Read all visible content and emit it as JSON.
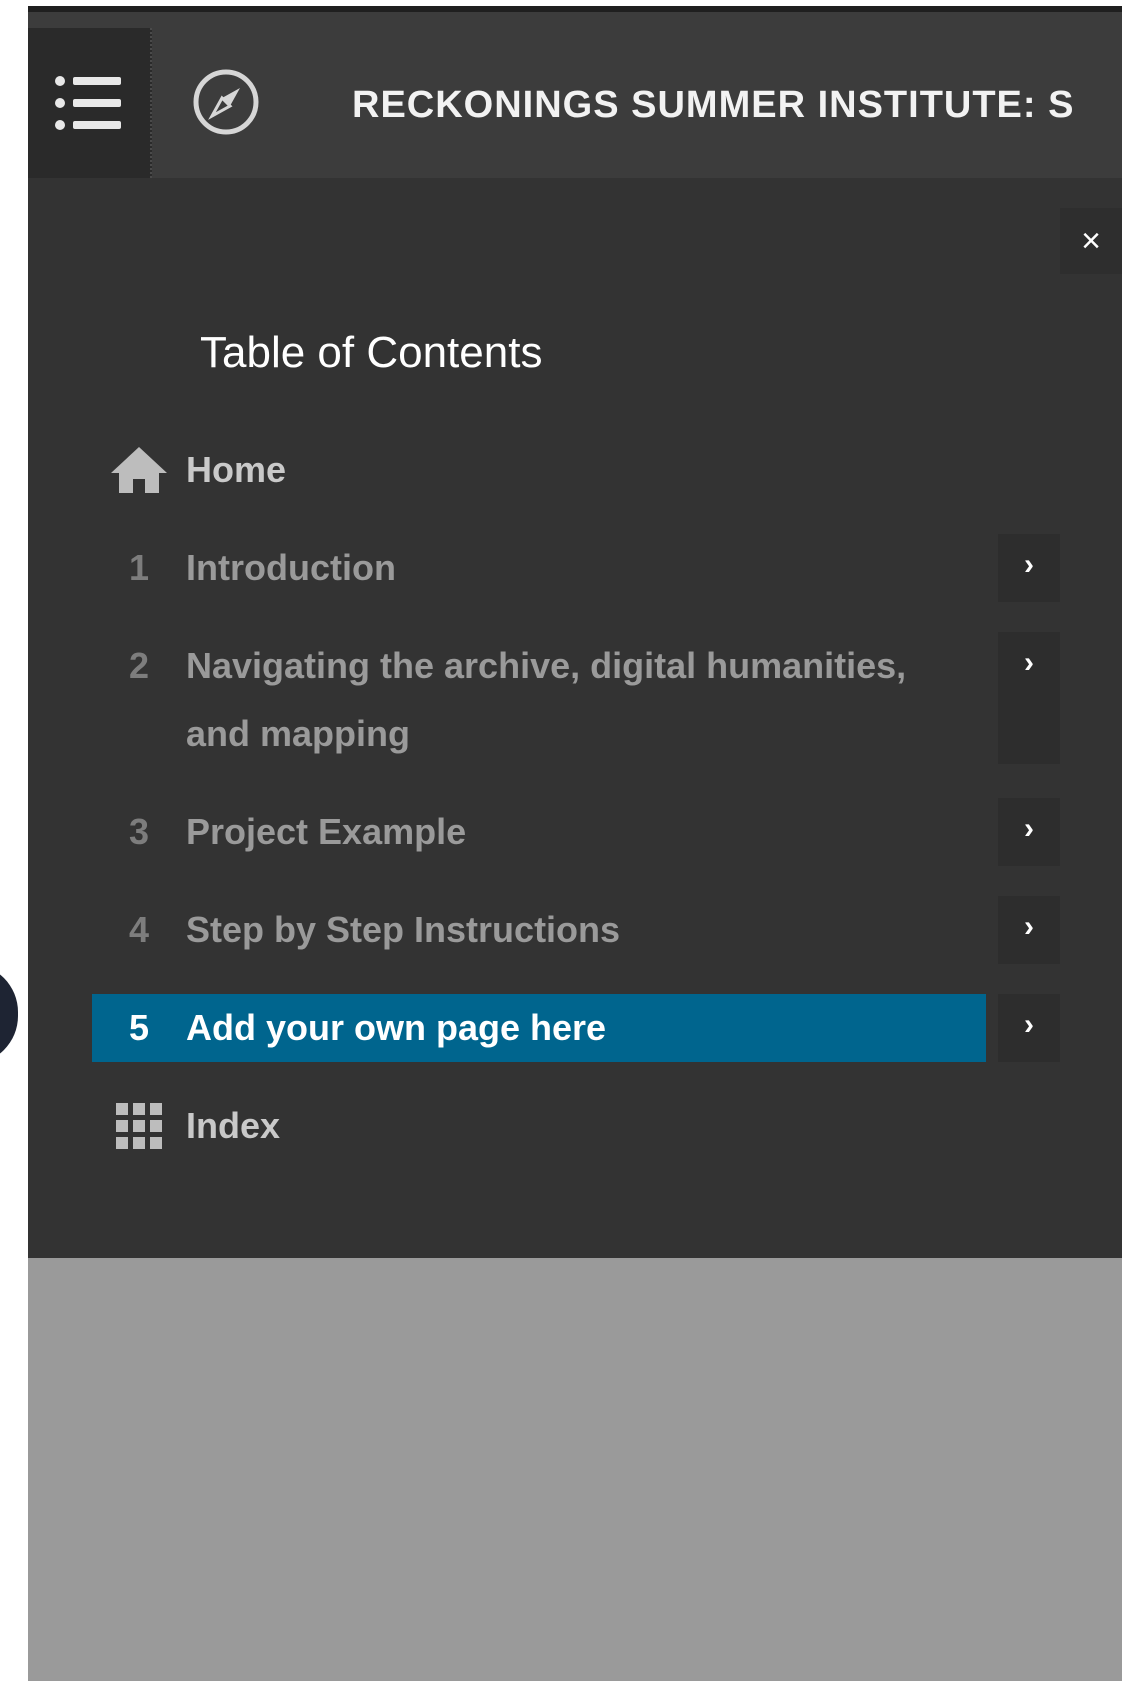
{
  "header": {
    "title": "RECKONINGS SUMMER INSTITUTE: S",
    "menu_icon": "list-icon",
    "compass_icon": "compass-icon"
  },
  "panel": {
    "close_label": "×",
    "heading": "Table of Contents",
    "home": {
      "label": "Home",
      "icon": "home-icon"
    },
    "items": [
      {
        "num": "1",
        "label": "Introduction"
      },
      {
        "num": "2",
        "label": "Navigating the archive, digital humanities, and mapping"
      },
      {
        "num": "3",
        "label": "Project Example"
      },
      {
        "num": "4",
        "label": "Step by Step Instructions"
      },
      {
        "num": "5",
        "label": "Add your own page here"
      }
    ],
    "index": {
      "label": "Index",
      "icon": "grid-icon"
    },
    "chevron": "›"
  },
  "colors": {
    "active": "#00658e",
    "panel": "#333333",
    "topbar": "#3c3c3c",
    "page": "#9a9a9a"
  }
}
